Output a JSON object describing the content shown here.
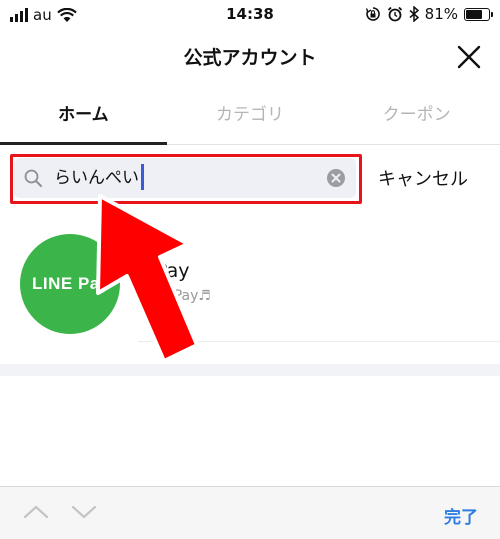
{
  "status_bar": {
    "carrier": "au",
    "time": "14:38",
    "battery_percent": "81%",
    "battery_level": 0.81,
    "icons": [
      "signal-icon",
      "wifi-icon",
      "lock-rotation-icon",
      "alarm-icon",
      "bluetooth-icon",
      "battery-icon"
    ]
  },
  "nav": {
    "title": "公式アカウント",
    "close_icon": "close-icon"
  },
  "tabs": [
    {
      "label": "ホーム",
      "active": true
    },
    {
      "label": "カテゴリ",
      "active": false
    },
    {
      "label": "クーポン",
      "active": false
    }
  ],
  "search": {
    "value": "らいんぺい",
    "cancel_label": "キャンセル",
    "search_icon": "search-icon",
    "clear_icon": "clear-icon"
  },
  "result": {
    "logo_text": "LINE Pay",
    "name": "E Pay",
    "description": "LINE Pay♬"
  },
  "toolbar": {
    "done_label": "完了",
    "icons": [
      "chevron-up-icon",
      "chevron-down-icon"
    ]
  },
  "colors": {
    "highlight": "#e8141a",
    "arrow": "#ff0000",
    "logo_bg": "#3bb54a",
    "accent": "#2f7de1",
    "caret": "#3a5bd9"
  }
}
